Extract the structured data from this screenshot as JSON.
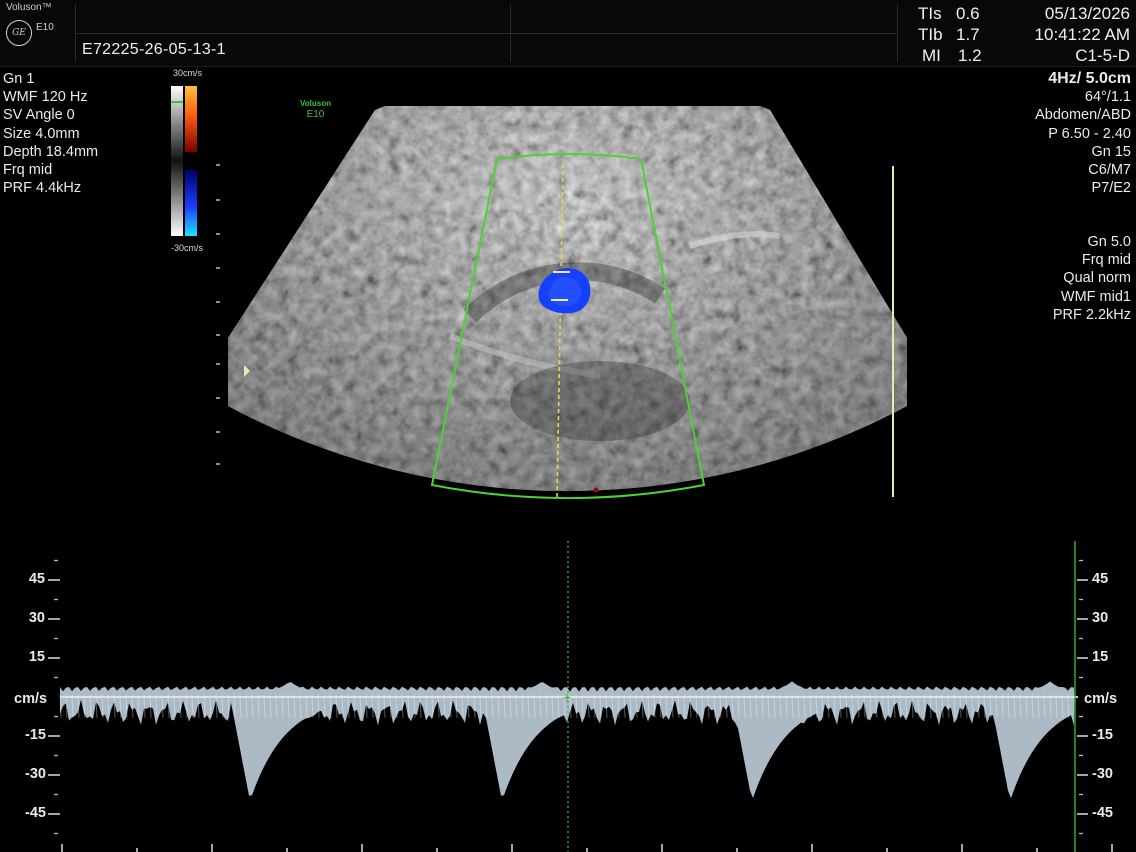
{
  "header": {
    "brand": "Voluson™",
    "model": "E10",
    "logo": "GE",
    "patient_id": "E72225-26-05-13-1",
    "indices": [
      {
        "label": "TIs",
        "value": "0.6"
      },
      {
        "label": "TIb",
        "value": "1.7"
      },
      {
        "label": "MI",
        "value": "1.2"
      }
    ],
    "date": "05/13/2026",
    "time": "10:41:22 AM",
    "probe": "C1-5-D"
  },
  "left_params": [
    "Gn  1",
    "WMF 120 Hz",
    "SV Angle  0",
    "Size  4.0mm",
    "Depth 18.4mm",
    "Frq mid",
    "PRF  4.4kHz"
  ],
  "right_params_top": {
    "headline": "4Hz/ 5.0cm",
    "lines": [
      "64°/1.1",
      "Abdomen/ABD",
      "P 6.50 - 2.40",
      "Gn  15",
      "C6/M7",
      "P7/E2"
    ]
  },
  "right_params_bottom": [
    "Gn  5.0",
    "Frq mid",
    "Qual norm",
    "WMF mid1",
    "PRF  2.2kHz"
  ],
  "color_bar": {
    "top_label": "30cm/s",
    "bottom_label": "-30cm/s"
  },
  "watermark": {
    "line1": "Voluson",
    "line2": "E10"
  },
  "spectral": {
    "unit": "cm/s",
    "ticks": [
      "45",
      "30",
      "15",
      "-15",
      "-30",
      "-45"
    ],
    "tick_values": [
      45,
      30,
      15,
      -15,
      -30,
      -45
    ],
    "range": [
      -55,
      55
    ]
  },
  "colors": {
    "accent_green": "#39c23a",
    "gate_yellow": "#e8d45a",
    "flow_blue": "#1540ff",
    "trace": "#c9dbe8"
  }
}
